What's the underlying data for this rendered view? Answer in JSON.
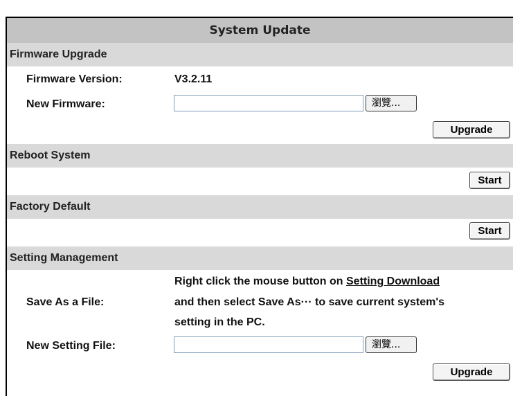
{
  "title": "System Update",
  "firmware_upgrade": {
    "section_label": "Firmware Upgrade",
    "version_label": "Firmware Version:",
    "version_value": "V3.2.11",
    "new_firmware_label": "New Firmware:",
    "new_firmware_value": "",
    "browse_label": "瀏覽...",
    "upgrade_button": "Upgrade"
  },
  "reboot_system": {
    "section_label": "Reboot System",
    "start_button": "Start"
  },
  "factory_default": {
    "section_label": "Factory Default",
    "start_button": "Start"
  },
  "setting_management": {
    "section_label": "Setting Management",
    "save_as_label": "Save As a File:",
    "desc_line1_prefix": "Right click the mouse button on ",
    "desc_link": "Setting Download",
    "desc_line2": "and then select Save As··· to save current system's",
    "desc_line3": "setting in the PC.",
    "new_setting_label": "New Setting File:",
    "new_setting_value": "",
    "browse_label": "瀏覽...",
    "upgrade_button": "Upgrade"
  },
  "colors": {
    "title_bar": "#c3c3c3",
    "section_bar": "#d9d9d9",
    "input_border": "#7f9db9"
  }
}
